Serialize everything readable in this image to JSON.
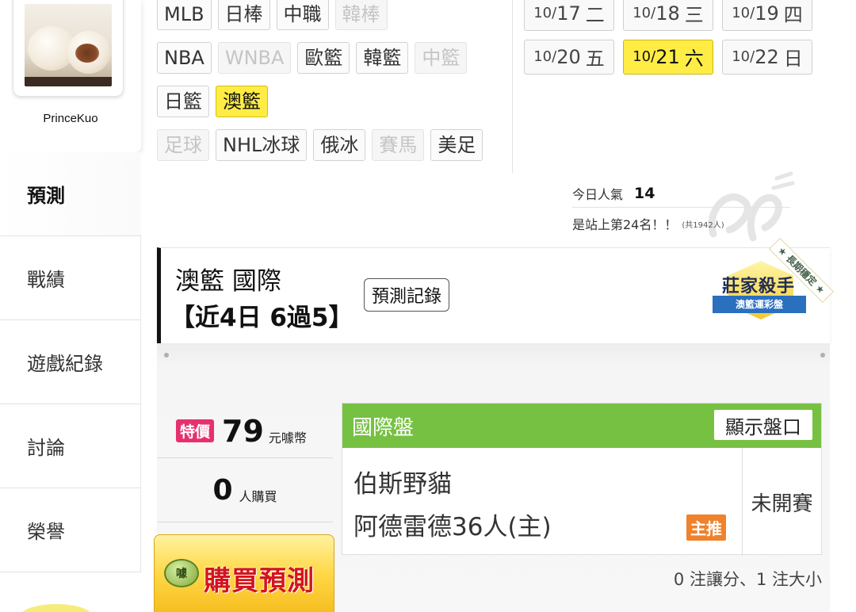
{
  "user": {
    "name": "PrinceKuo"
  },
  "nav": [
    {
      "label": "預測",
      "active": true
    },
    {
      "label": "戰績"
    },
    {
      "label": "遊戲紀錄"
    },
    {
      "label": "討論"
    },
    {
      "label": "榮譽"
    }
  ],
  "categories": [
    [
      {
        "label": "MLB"
      },
      {
        "label": "日棒"
      },
      {
        "label": "中職"
      },
      {
        "label": "韓棒",
        "disabled": true
      }
    ],
    [
      {
        "label": "NBA"
      },
      {
        "label": "WNBA",
        "disabled": true
      },
      {
        "label": "歐籃"
      },
      {
        "label": "韓籃"
      },
      {
        "label": "中籃",
        "disabled": true
      }
    ],
    [
      {
        "label": "日籃"
      },
      {
        "label": "澳籃",
        "selected": true
      }
    ],
    [
      {
        "label": "足球",
        "disabled": true
      },
      {
        "label": "NHL冰球"
      },
      {
        "label": "俄冰"
      },
      {
        "label": "賽馬",
        "disabled": true
      },
      {
        "label": "美足"
      }
    ]
  ],
  "dates": [
    [
      {
        "month": "10/",
        "day": "17",
        "weekday": "二"
      },
      {
        "month": "10/",
        "day": "18",
        "weekday": "三"
      },
      {
        "month": "10/",
        "day": "19",
        "weekday": "四"
      }
    ],
    [
      {
        "month": "10/",
        "day": "20",
        "weekday": "五"
      },
      {
        "month": "10/",
        "day": "21",
        "weekday": "六",
        "selected": true
      },
      {
        "month": "10/",
        "day": "22",
        "weekday": "日"
      }
    ]
  ],
  "popularity": {
    "label": "今日人氣",
    "value": "14",
    "rank_text": "是站上第24名！！",
    "total_text": "(共1942人)"
  },
  "prediction": {
    "title": "澳籃 國際",
    "record": "【近4日 6過5】",
    "history_button": "預測記錄",
    "badge": {
      "main": "莊家殺手",
      "sub": "澳籃運彩盤",
      "corner": "★ 長期穩定 ★"
    },
    "price": {
      "tag": "特價",
      "value": "79",
      "unit": "元噱幣"
    },
    "buyers": {
      "value": "0",
      "unit": "人購買"
    },
    "buy_button": {
      "coin": "噱",
      "label": "購買預測"
    },
    "game": {
      "market": "國際盤",
      "show_button": "顯示盤口",
      "away": "伯斯野貓",
      "home": "阿德雷德36人(主)",
      "pick_tag": "主推",
      "status": "未開賽"
    },
    "summary": "0 注讓分、1 注大小"
  },
  "colors": {
    "selected_yellow": "#ffec45",
    "market_green": "#77c142",
    "special_pink": "#e6316d",
    "pick_orange": "#f0822c",
    "buy_red": "#d3141f"
  }
}
